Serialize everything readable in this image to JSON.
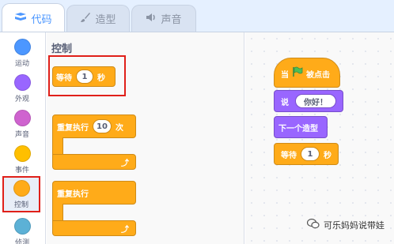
{
  "tabs": [
    {
      "label": "代码",
      "icon": "code-icon"
    },
    {
      "label": "造型",
      "icon": "brush-icon"
    },
    {
      "label": "声音",
      "icon": "speaker-icon"
    }
  ],
  "categories": [
    {
      "label": "运动",
      "color": "#4c97ff"
    },
    {
      "label": "外观",
      "color": "#9966ff"
    },
    {
      "label": "声音",
      "color": "#cf63cf"
    },
    {
      "label": "事件",
      "color": "#ffbf00"
    },
    {
      "label": "控制",
      "color": "#ffab19"
    },
    {
      "label": "侦测",
      "color": "#5cb1d6"
    }
  ],
  "palette": {
    "title": "控制",
    "wait_block": {
      "prefix": "等待",
      "value": "1",
      "suffix": "秒"
    },
    "repeat_block": {
      "label": "重复执行",
      "value": "10",
      "suffix": "次"
    },
    "forever_block": {
      "label": "重复执行"
    },
    "loop_arrow": "⤴"
  },
  "script": {
    "hat": {
      "prefix": "当",
      "suffix": "被点击",
      "flag_color": "#4cbf56"
    },
    "say": {
      "label": "说",
      "value": "你好！"
    },
    "next_costume": {
      "label": "下一个造型"
    },
    "wait": {
      "prefix": "等待",
      "value": "1",
      "suffix": "秒"
    }
  },
  "watermark": {
    "text": "可乐妈妈说带娃",
    "icon": "wechat-icon"
  },
  "colors": {
    "control": "#ffab19",
    "looks": "#9966ff",
    "highlight": "#e0201a",
    "accent": "#4c97ff"
  }
}
